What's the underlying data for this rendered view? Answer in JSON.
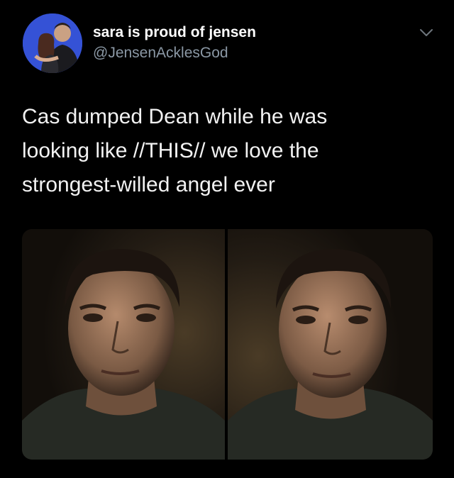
{
  "tweet": {
    "author": {
      "display_name": "sara is proud of jensen",
      "handle": "@JensenAcklesGod",
      "avatar_icon": "profile-photo"
    },
    "menu_icon": "chevron-down-icon",
    "text_lines": [
      "Cas dumped Dean while he was",
      "looking like //THIS// we love the",
      "strongest-willed angel ever"
    ],
    "media": {
      "count": 2,
      "items": [
        {
          "icon": "photo-man-face-left"
        },
        {
          "icon": "photo-man-face-right"
        }
      ]
    }
  },
  "colors": {
    "background": "#000000",
    "name": "#ffffff",
    "handle": "#8b98a5",
    "text": "#f2f2f2"
  }
}
